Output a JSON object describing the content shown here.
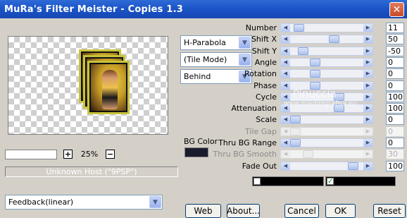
{
  "window": {
    "title": "MuRa's Filter Meister - Copies 1.3",
    "close_glyph": "✕"
  },
  "preview": {
    "zoom_value": "",
    "zoom_label": "25%",
    "zoom_in_glyph": "+",
    "zoom_out_glyph": "−"
  },
  "status": {
    "text": "Unknown Host (\"9PSP\")"
  },
  "dropdowns": {
    "mode": "H-Parabola",
    "tile": "(Tile Mode)",
    "order": "Behind",
    "feedback": "Feedback(linear)"
  },
  "bg_color": {
    "label": "BG Color",
    "color": "#1b1b2e"
  },
  "sliders": [
    {
      "label": "Number",
      "value": "11",
      "pos": 0.06,
      "enabled": true
    },
    {
      "label": "Shift X",
      "value": "50",
      "pos": 0.62,
      "enabled": true
    },
    {
      "label": "Shift Y",
      "value": "-50",
      "pos": 0.12,
      "enabled": true
    },
    {
      "label": "Angle",
      "value": "0",
      "pos": 0.32,
      "enabled": true
    },
    {
      "label": "Rotation",
      "value": "0",
      "pos": 0.32,
      "enabled": true
    },
    {
      "label": "Phase",
      "value": "0",
      "pos": 0.32,
      "enabled": true
    },
    {
      "label": "Cycle",
      "value": "100",
      "pos": 0.7,
      "enabled": true
    },
    {
      "label": "Attenuation",
      "value": "100",
      "pos": 0.7,
      "enabled": true
    },
    {
      "label": "Scale",
      "value": "0",
      "pos": 0.0,
      "enabled": true
    },
    {
      "label": "Tile Gap",
      "value": "0",
      "pos": 0.0,
      "enabled": false
    },
    {
      "label": "Thru BG Range",
      "value": "0",
      "pos": 0.0,
      "enabled": true
    },
    {
      "label": "Thru BG Smooth",
      "value": "30",
      "pos": 0.2,
      "enabled": false
    },
    {
      "label": "Fade Out",
      "value": "100",
      "pos": 0.92,
      "enabled": true
    }
  ],
  "watermark": {
    "name": "Pinuccia",
    "url": "www.maidiregrafica.eu"
  },
  "color_bars": {
    "left_checked": false,
    "right_checked": true,
    "check_glyph": "✓"
  },
  "buttons": {
    "web": "Web",
    "about": "About...",
    "cancel": "Cancel",
    "ok": "OK",
    "reset": "Reset"
  },
  "icons": {
    "arrow_left": "◀",
    "arrow_right": "▶",
    "arrow_down": "▼"
  }
}
